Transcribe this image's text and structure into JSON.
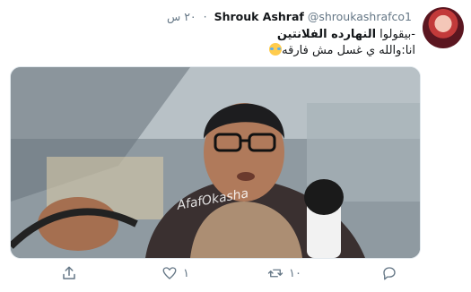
{
  "tweet": {
    "display_name": "Shrouk Ashraf",
    "handle": "@shroukashrafco1",
    "separator": "·",
    "time": "٢٠ س",
    "text_line1_prefix": "-بيقولوا ",
    "text_line1_bold": "النهارده الفلانتين",
    "text_line2": "انا:والله ي غسل مش فارقه",
    "media": {
      "watermark": "AfafOkasha"
    },
    "actions": {
      "reply_count": "",
      "retweet_count": "١٠",
      "like_count": "١",
      "share_count": ""
    }
  },
  "colors": {
    "text": "#14171a",
    "secondary": "#657786",
    "border": "#e1e8ed"
  },
  "icons": [
    "reply-icon",
    "retweet-icon",
    "like-icon",
    "share-icon",
    "face-with-tears-of-joy-emoji"
  ]
}
